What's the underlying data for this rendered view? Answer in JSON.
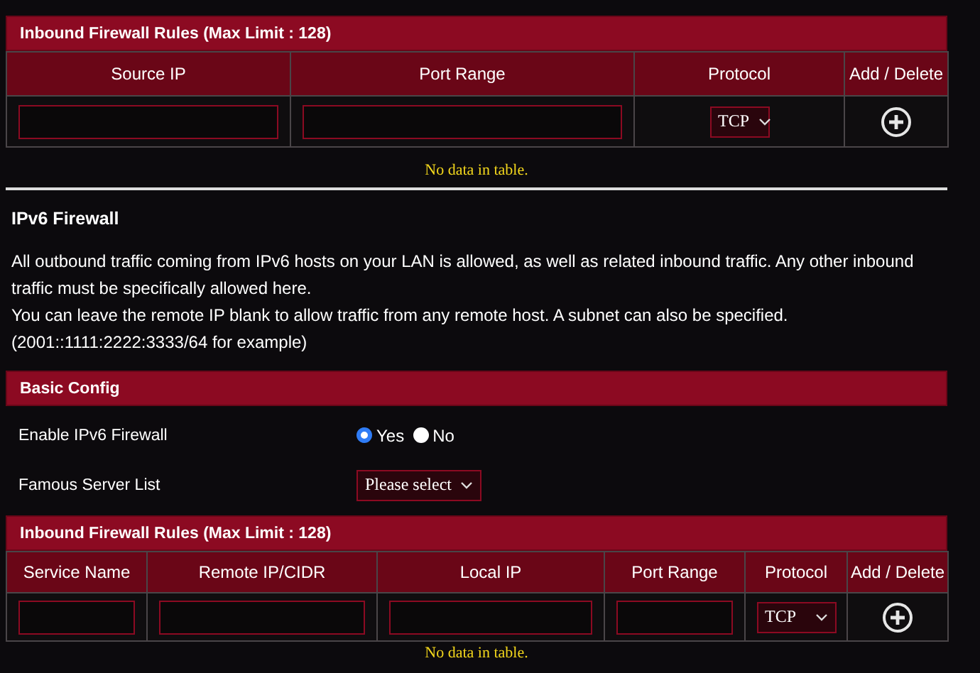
{
  "top_rules": {
    "title": "Inbound Firewall Rules (Max Limit : 128)",
    "columns": [
      "Source IP",
      "Port Range",
      "Protocol",
      "Add / Delete"
    ],
    "cells": [
      {
        "kind": "input"
      },
      {
        "kind": "input"
      },
      {
        "kind": "select",
        "value": "TCP"
      },
      {
        "kind": "add"
      }
    ],
    "empty_message": "No data in table."
  },
  "section": {
    "title": "IPv6 Firewall",
    "paragraphs": [
      "All outbound traffic coming from IPv6 hosts on your LAN is allowed, as well as related inbound traffic. Any other inbound traffic must be specifically allowed here.",
      "You can leave the remote IP blank to allow traffic from any remote host. A subnet can also be specified.",
      "(2001::1111:2222:3333/64 for example)"
    ]
  },
  "basic_config": {
    "title": "Basic Config",
    "rows": [
      {
        "kind": "radio",
        "label": "Enable IPv6 Firewall",
        "options": [
          {
            "label": "Yes",
            "selected": true
          },
          {
            "label": "No",
            "selected": false
          }
        ]
      },
      {
        "kind": "select",
        "label": "Famous Server List",
        "value": "Please select"
      }
    ]
  },
  "bottom_rules": {
    "title": "Inbound Firewall Rules (Max Limit : 128)",
    "columns": [
      "Service Name",
      "Remote IP/CIDR",
      "Local IP",
      "Port Range",
      "Protocol",
      "Add / Delete"
    ],
    "cells": [
      {
        "kind": "input"
      },
      {
        "kind": "input"
      },
      {
        "kind": "input"
      },
      {
        "kind": "input"
      },
      {
        "kind": "select",
        "value": "TCP"
      },
      {
        "kind": "add"
      }
    ],
    "empty_message": "No data in table."
  }
}
